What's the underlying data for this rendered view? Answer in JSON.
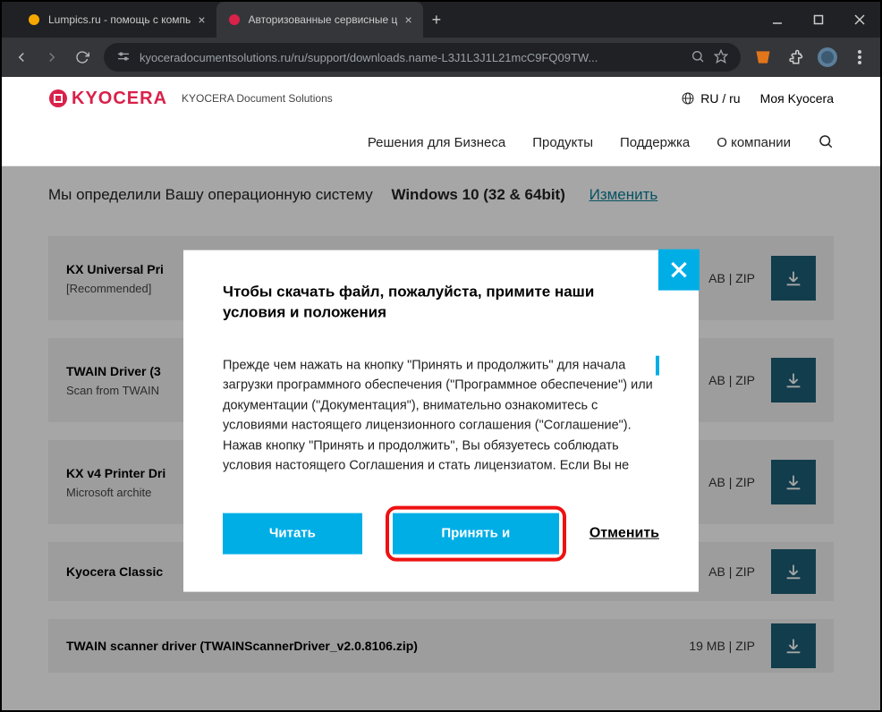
{
  "browser": {
    "tabs": [
      {
        "title": "Lumpics.ru - помощь с компь",
        "active": false
      },
      {
        "title": "Авторизованные сервисные ц",
        "active": true
      }
    ],
    "url_display": "kyoceradocumentsolutions.ru/ru/support/downloads.name-L3J1L3J1L21mcC9FQ09TW..."
  },
  "site": {
    "brand": "KYOCERA",
    "sub_brand": "KYOCERA Document Solutions",
    "region": "RU / ru",
    "account": "Моя Kyocera",
    "nav": {
      "biz": "Решения для Бизнеса",
      "products": "Продукты",
      "support": "Поддержка",
      "about": "О компании"
    }
  },
  "os_bar": {
    "label": "Мы определили Вашу операционную систему",
    "value": "Windows 10 (32 & 64bit)",
    "change": "Изменить"
  },
  "drivers": [
    {
      "title": "KX Universal Pri",
      "sub": "[Recommended]",
      "meta": "АB  |  ZIP"
    },
    {
      "title": "TWAIN Driver (3",
      "sub": "Scan from TWAIN",
      "meta": "АB  |  ZIP"
    },
    {
      "title": "KX v4 Printer Dri",
      "sub": "Microsoft archite",
      "meta": "АB  |  ZIP"
    },
    {
      "title": "Kyocera Classic",
      "sub": "",
      "meta": "АB  |  ZIP"
    },
    {
      "title": "TWAIN scanner driver (TWAINScannerDriver_v2.0.8106.zip)",
      "sub": "",
      "meta": "19 MB  |  ZIP"
    }
  ],
  "modal": {
    "heading": "Чтобы скачать файл, пожалуйста, примите наши условия и положения",
    "body": "Прежде чем нажать на кнопку \"Принять и продолжить\" для начала загрузки программного обеспечения (\"Программное обеспечение\") или документации (\"Документация\"), внимательно ознакомитесь с условиями настоящего лицензионного соглашения (\"Соглашение\"). Нажав кнопку \"Принять и продолжить\", Вы обязуетесь соблюдать условия настоящего Соглашения и стать лицензиатом. Если Вы не согласны со всеми условиями настоящего",
    "read": "Читать",
    "accept": "Принять и",
    "cancel": "Отменить"
  }
}
